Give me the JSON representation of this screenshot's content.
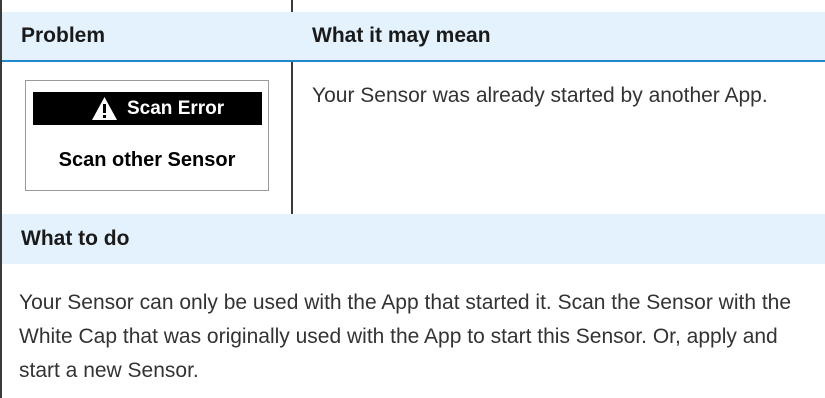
{
  "table": {
    "header": {
      "problem": "Problem",
      "meaning": "What it may mean"
    },
    "screen": {
      "icon": "warning-triangle-icon",
      "title": "Scan Error",
      "message": "Scan other Sensor"
    },
    "meaning_text": "Your Sensor was already started by another App.",
    "todo": {
      "heading": "What to do",
      "text": "Your Sensor can only be used with the App that started it. Scan the Sensor with the White Cap that was originally used with the App to start this Sensor. Or, apply and start a new Sensor."
    }
  },
  "colors": {
    "header_bg": "#e3f2fc",
    "header_rule": "#1e88c8",
    "table_line": "#3a3a3a",
    "screen_bar": "#000000"
  }
}
